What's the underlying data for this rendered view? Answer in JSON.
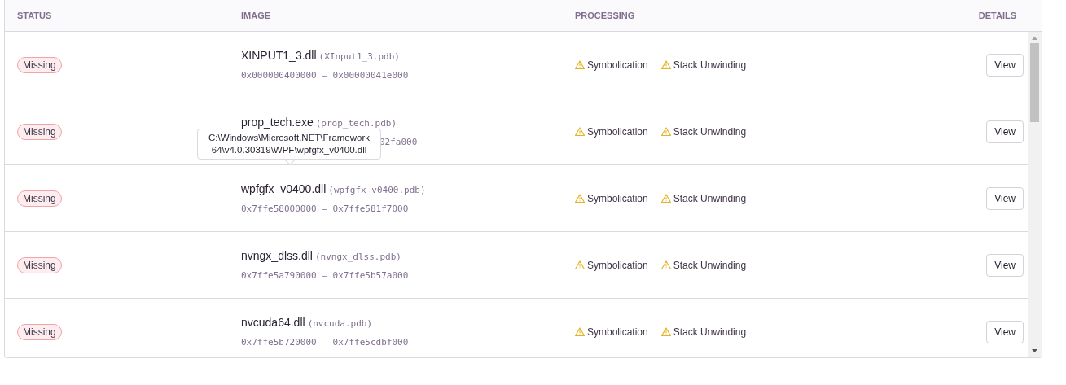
{
  "table": {
    "columns": [
      "STATUS",
      "IMAGE",
      "PROCESSING",
      "DETAILS"
    ],
    "rows": [
      {
        "status": {
          "label": "Missing",
          "kind": "missing"
        },
        "name": "XINPUT1_3.dll",
        "debug_file": "(XInput1_3.pdb)",
        "address": "0x000000400000 – 0x00000041e000",
        "processing": [
          {
            "label": "Symbolication",
            "kind": "warning"
          },
          {
            "label": "Stack Unwinding",
            "kind": "warning"
          }
        ],
        "action": "View"
      },
      {
        "status": {
          "label": "Missing",
          "kind": "missing"
        },
        "name": "prop_tech.exe",
        "debug_file": "(prop_tech.pdb)",
        "address": "02fa000",
        "address_covered": true,
        "processing": [
          {
            "label": "Symbolication",
            "kind": "warning"
          },
          {
            "label": "Stack Unwinding",
            "kind": "warning"
          }
        ],
        "action": "View"
      },
      {
        "status": {
          "label": "Missing",
          "kind": "missing"
        },
        "tooltip": "C:\\Windows\\Microsoft.NET\\Framework64\\v4.0.30319\\WPF\\wpfgfx_v0400.dll",
        "name": "wpfgfx_v0400.dll",
        "debug_file": "(wpfgfx_v0400.pdb)",
        "address": "0x7ffe58000000 – 0x7ffe581f7000",
        "processing": [
          {
            "label": "Symbolication",
            "kind": "warning"
          },
          {
            "label": "Stack Unwinding",
            "kind": "warning"
          }
        ],
        "action": "View"
      },
      {
        "status": {
          "label": "Missing",
          "kind": "missing"
        },
        "name": "nvngx_dlss.dll",
        "debug_file": "(nvngx_dlss.pdb)",
        "address": "0x7ffe5a790000 – 0x7ffe5b57a000",
        "processing": [
          {
            "label": "Symbolication",
            "kind": "warning"
          },
          {
            "label": "Stack Unwinding",
            "kind": "warning"
          }
        ],
        "action": "View"
      },
      {
        "status": {
          "label": "Missing",
          "kind": "missing"
        },
        "name": "nvcuda64.dll",
        "debug_file": "(nvcuda.pdb)",
        "address": "0x7ffe5b720000 – 0x7ffe5cdbf000",
        "processing": [
          {
            "label": "Symbolication",
            "kind": "warning"
          },
          {
            "label": "Stack Unwinding",
            "kind": "warning"
          }
        ],
        "action": "View"
      }
    ]
  }
}
